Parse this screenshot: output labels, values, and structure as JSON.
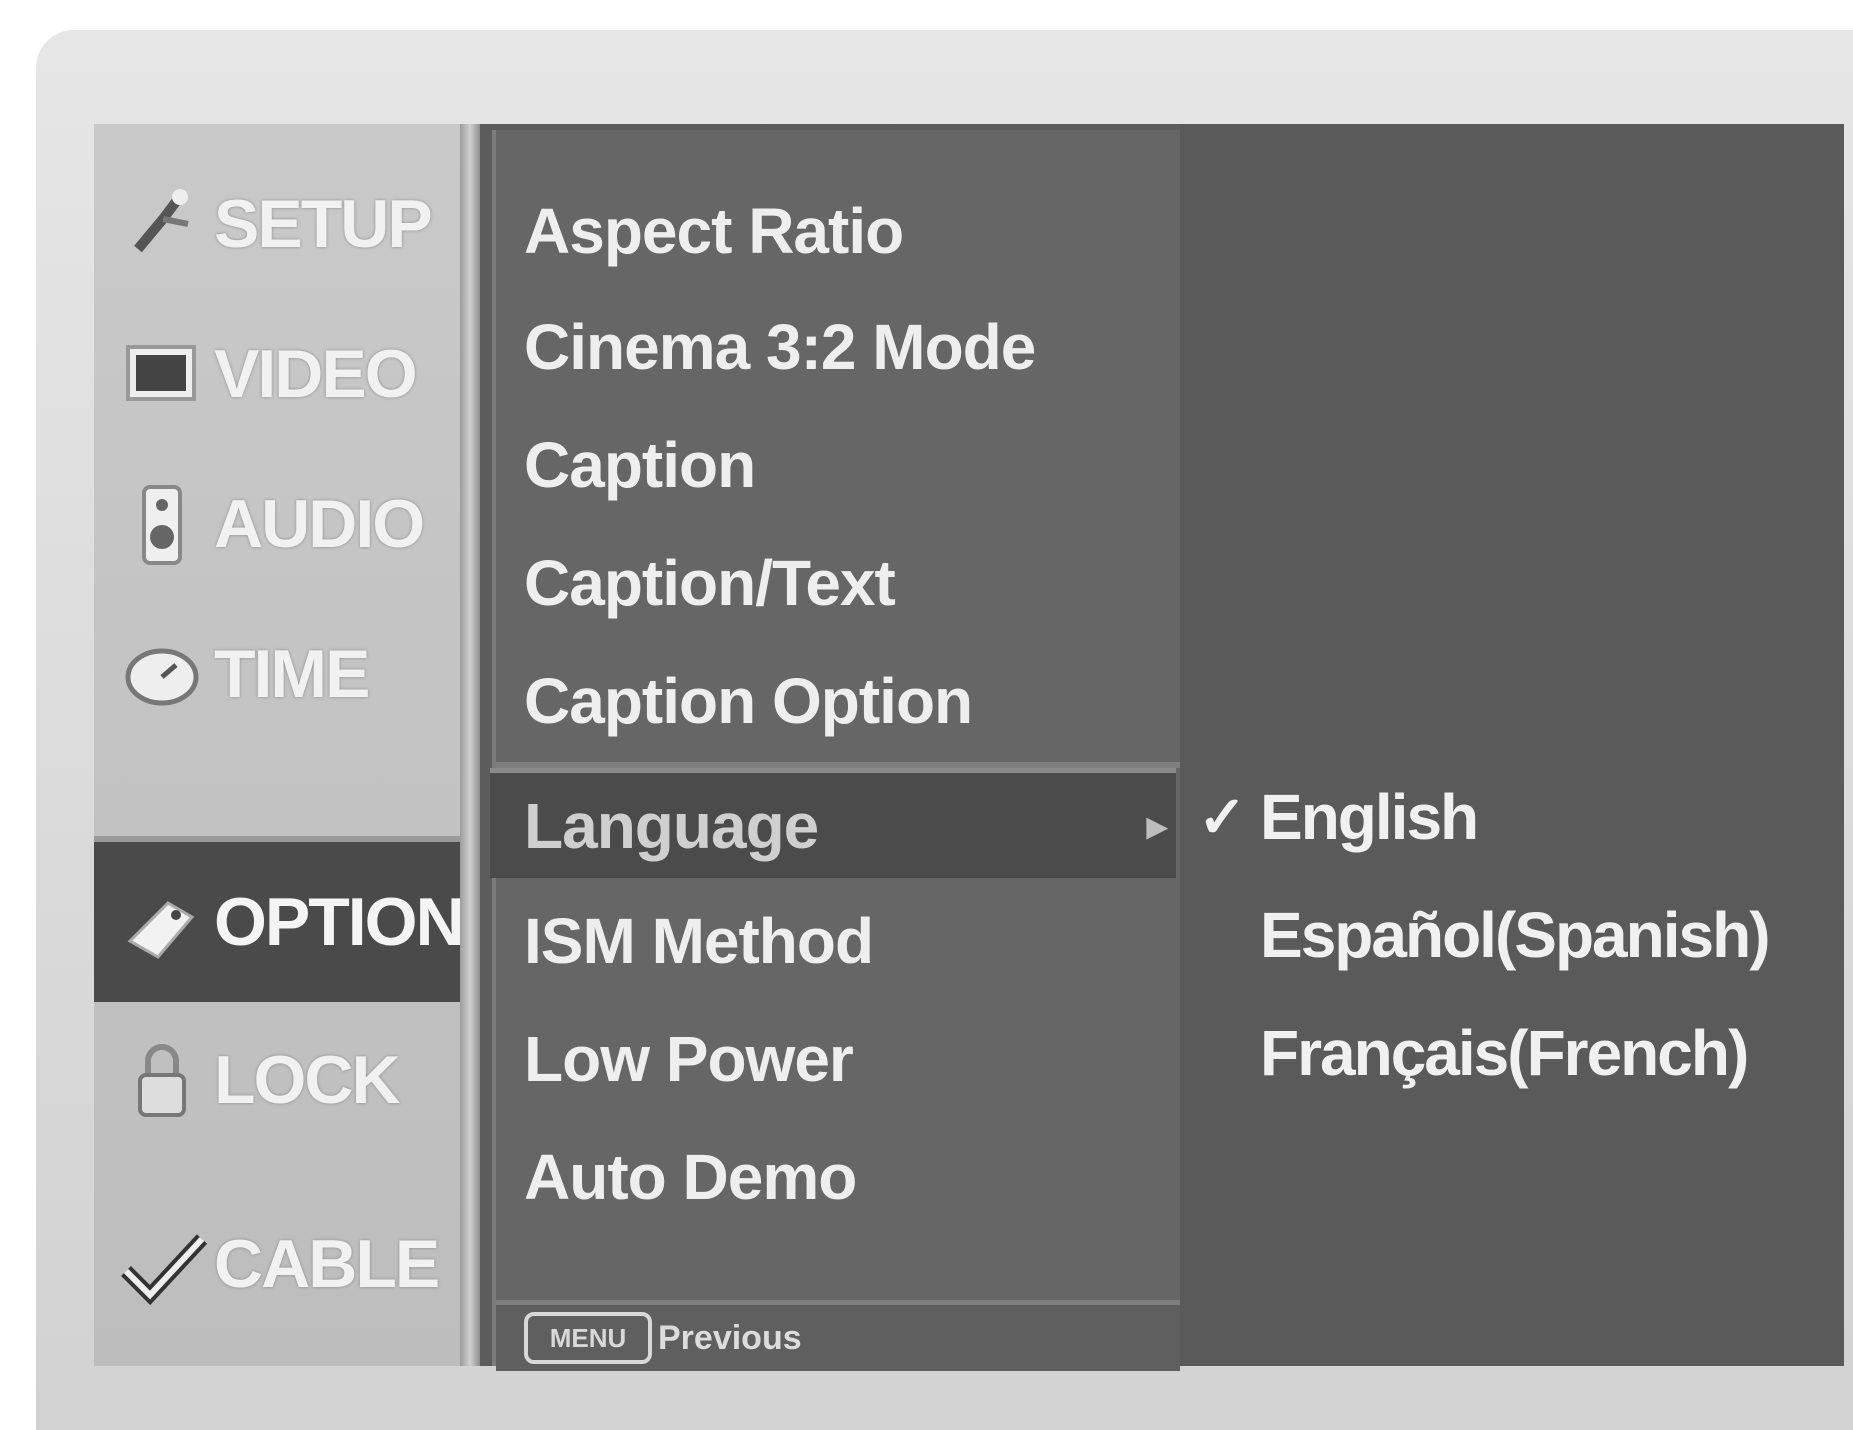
{
  "categories": [
    {
      "label": "SETUP",
      "icon": "satellite-dish-icon"
    },
    {
      "label": "VIDEO",
      "icon": "screen-icon"
    },
    {
      "label": "AUDIO",
      "icon": "speaker-icon"
    },
    {
      "label": "TIME",
      "icon": "clock-icon"
    },
    {
      "label": "OPTION",
      "icon": "tag-icon",
      "selected": true
    },
    {
      "label": "LOCK",
      "icon": "padlock-icon"
    },
    {
      "label": "CABLE",
      "icon": "checkmark-icon"
    }
  ],
  "option_menu": {
    "items": [
      {
        "label": "Aspect Ratio"
      },
      {
        "label": "Cinema 3:2 Mode"
      },
      {
        "label": "Caption"
      },
      {
        "label": "Caption/Text"
      },
      {
        "label": "Caption Option"
      },
      {
        "label": "Language",
        "highlighted": true,
        "has_submenu": true
      },
      {
        "label": "ISM Method"
      },
      {
        "label": "Low Power"
      },
      {
        "label": "Auto Demo"
      }
    ],
    "submenu_arrow": "▸",
    "footer": {
      "key_label": "MENU",
      "label": "Previous"
    }
  },
  "language_options": {
    "check_mark": "✓",
    "options": [
      {
        "label": "English",
        "selected": true
      },
      {
        "label": "Español(Spanish)"
      },
      {
        "label": "Français(French)"
      }
    ]
  },
  "colors": {
    "selected_background": "#4a4a4a",
    "menu_background": "#666666",
    "category_background": "#c4c4c4"
  }
}
